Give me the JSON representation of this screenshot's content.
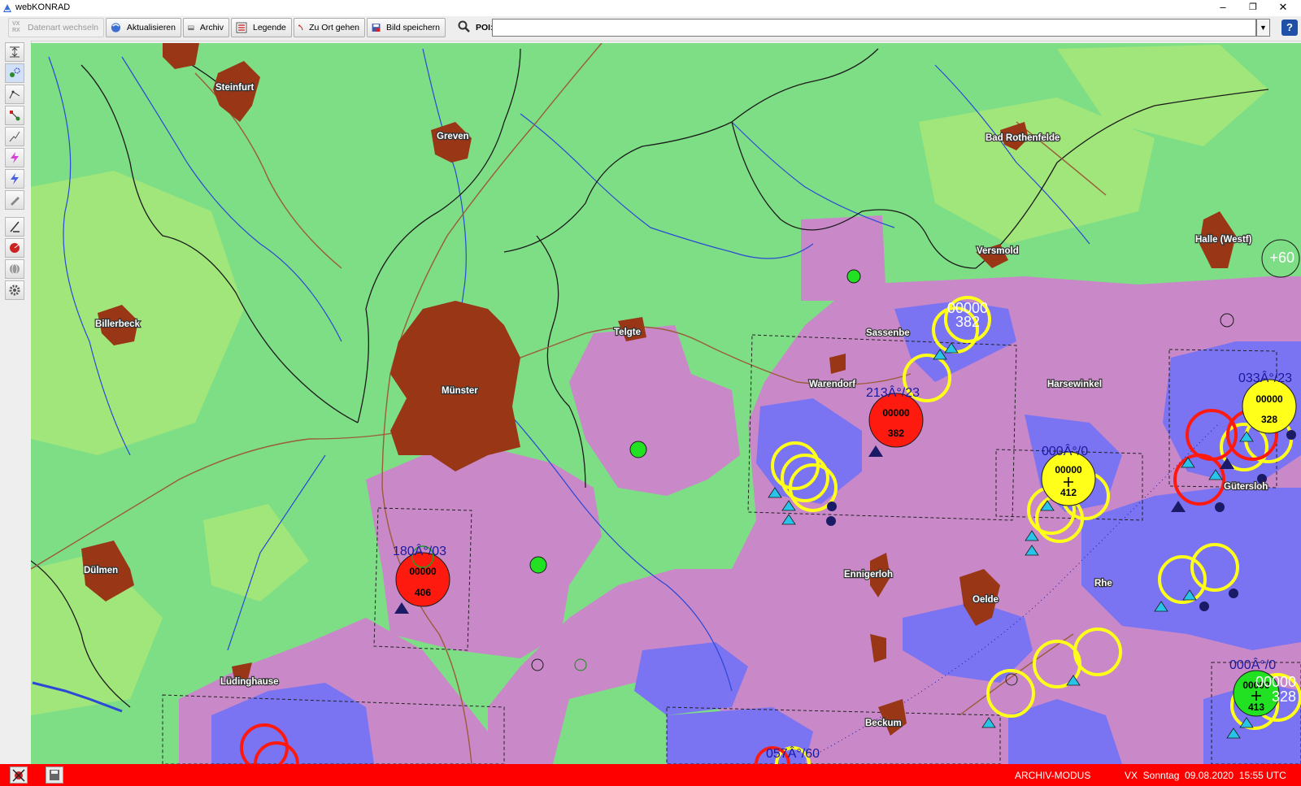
{
  "window": {
    "title": "webKONRAD",
    "controls": {
      "minimize": "–",
      "maximize": "❐",
      "close": "✕"
    }
  },
  "toolbar": {
    "datenart_label": "Datenart wechseln",
    "aktualisieren_label": "Aktualisieren",
    "archiv_label": "Archiv",
    "legende_label": "Legende",
    "zu_ort_label": "Zu Ort gehen",
    "bild_speichern_label": "Bild speichern",
    "poi_label": "POI:",
    "poi_value": "",
    "help_label": "?"
  },
  "map": {
    "colors": {
      "background": "#7ede85",
      "light_green": "#a1e67a",
      "pink": "#c988c8",
      "blue": "#7a73f2",
      "city": "#993616",
      "cell_red": "#ff1a10",
      "cell_yellow": "#ffff1a",
      "cell_green": "#22e022",
      "triangle_cyan": "#27c3e8",
      "triangle_dark": "#1a1a66",
      "river": "#2b48d6",
      "border": "#1a1a1a",
      "road": "#9b5c3a"
    },
    "towns": [
      {
        "name": "Steinfurt"
      },
      {
        "name": "Greven"
      },
      {
        "name": "Bad Rothenfelde"
      },
      {
        "name": "Versmold"
      },
      {
        "name": "Halle (Westf)"
      },
      {
        "name": "Billerbeck"
      },
      {
        "name": "Telgte"
      },
      {
        "name": "Sassenbe"
      },
      {
        "name": "Warendorf"
      },
      {
        "name": "Harsewinkel"
      },
      {
        "name": "Münster"
      },
      {
        "name": "Gütersloh"
      },
      {
        "name": "Dülmen"
      },
      {
        "name": "Ennigerloh"
      },
      {
        "name": "Oelde"
      },
      {
        "name": "Rhe"
      },
      {
        "name": "Lüdinghause"
      },
      {
        "name": "Beckum"
      }
    ],
    "cells": [
      {
        "color": "red",
        "top": "00000",
        "bottom": "382",
        "motion": "213Â°/23"
      },
      {
        "color": "red",
        "top": "00000",
        "bottom": "406",
        "motion": "180Â°/03"
      },
      {
        "color": "yellow",
        "top": "00000",
        "bottom": "412",
        "motion": "000Â°/0"
      },
      {
        "color": "yellow",
        "top": "00000",
        "bottom": "328",
        "motion": "033Â°/23"
      },
      {
        "color": "green",
        "top": "00000",
        "bottom": "413",
        "motion": "000Â°/0"
      }
    ],
    "extra_labels": {
      "ring_382_top": "00000",
      "ring_382_bottom": "382",
      "ring_328_top": "00000",
      "ring_328_bottom": "328",
      "motion_bottom": "057Â°/60",
      "plus60": "+60"
    }
  },
  "status": {
    "mode": "ARCHIV-MODUS",
    "info": "VX  Sonntag  09.08.2020  15:55 UTC"
  }
}
